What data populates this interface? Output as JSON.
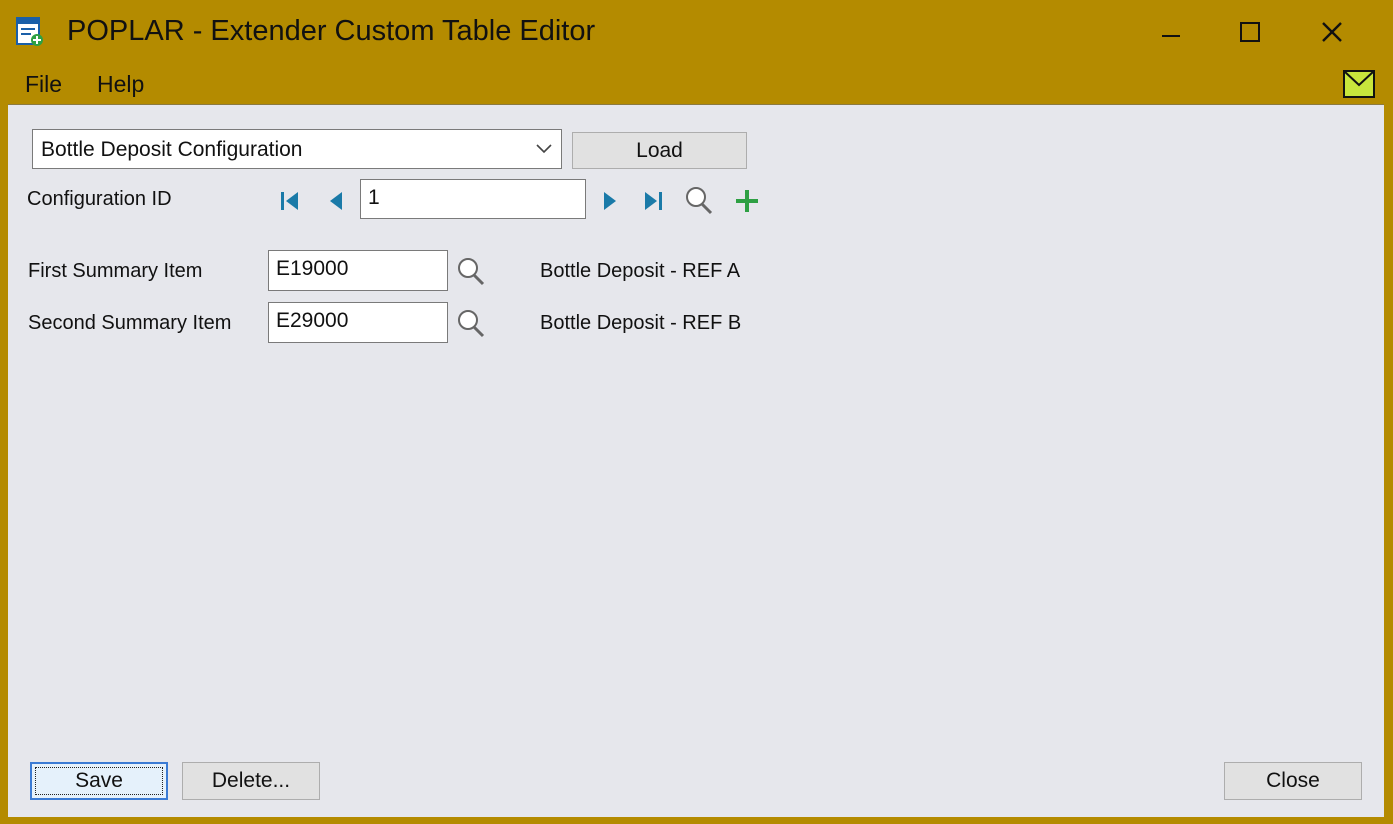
{
  "window": {
    "title": "POPLAR - Extender Custom Table Editor",
    "minimize_label": "minimize",
    "maximize_label": "maximize",
    "close_label": "close"
  },
  "menu": {
    "items": [
      {
        "label": "File"
      },
      {
        "label": "Help"
      }
    ]
  },
  "table_select": {
    "value": "Bottle Deposit Configuration",
    "load_label": "Load"
  },
  "config_id": {
    "label": "Configuration ID",
    "value": "1"
  },
  "fields": [
    {
      "label": "First Summary Item",
      "value": "E19000",
      "description": "Bottle Deposit - REF A"
    },
    {
      "label": "Second Summary Item",
      "value": "E29000",
      "description": "Bottle Deposit - REF B"
    }
  ],
  "buttons": {
    "save": "Save",
    "delete": "Delete...",
    "close": "Close"
  },
  "colors": {
    "titlebar": "#b48b00",
    "nav_arrow": "#1a7aa8",
    "add_icon": "#2ea043",
    "mail_icon": "#c8e63c"
  }
}
